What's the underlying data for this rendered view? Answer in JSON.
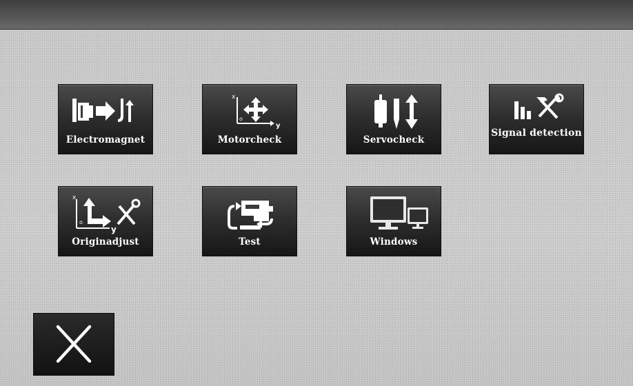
{
  "tiles": [
    {
      "label": "Electromagnet",
      "icon": "electromagnet-icon"
    },
    {
      "label": "Motorcheck",
      "icon": "motor-xy-icon",
      "icon_text": [
        "x",
        "o",
        "y"
      ]
    },
    {
      "label": "Servocheck",
      "icon": "servo-icon"
    },
    {
      "label": "Signal detection",
      "icon": "signal-tools-icon"
    },
    {
      "label": "Originadjust",
      "icon": "origin-adjust-icon",
      "icon_text": [
        "x",
        "o",
        "y"
      ]
    },
    {
      "label": "Test",
      "icon": "test-cycle-icon"
    },
    {
      "label": "Windows",
      "icon": "monitors-icon"
    }
  ],
  "close": {
    "icon": "close-icon"
  },
  "colors": {
    "background": "#cfcfcf",
    "top_bar": "#4a4a4a",
    "tile": "#2f2f2f",
    "label": "#ffffff"
  }
}
